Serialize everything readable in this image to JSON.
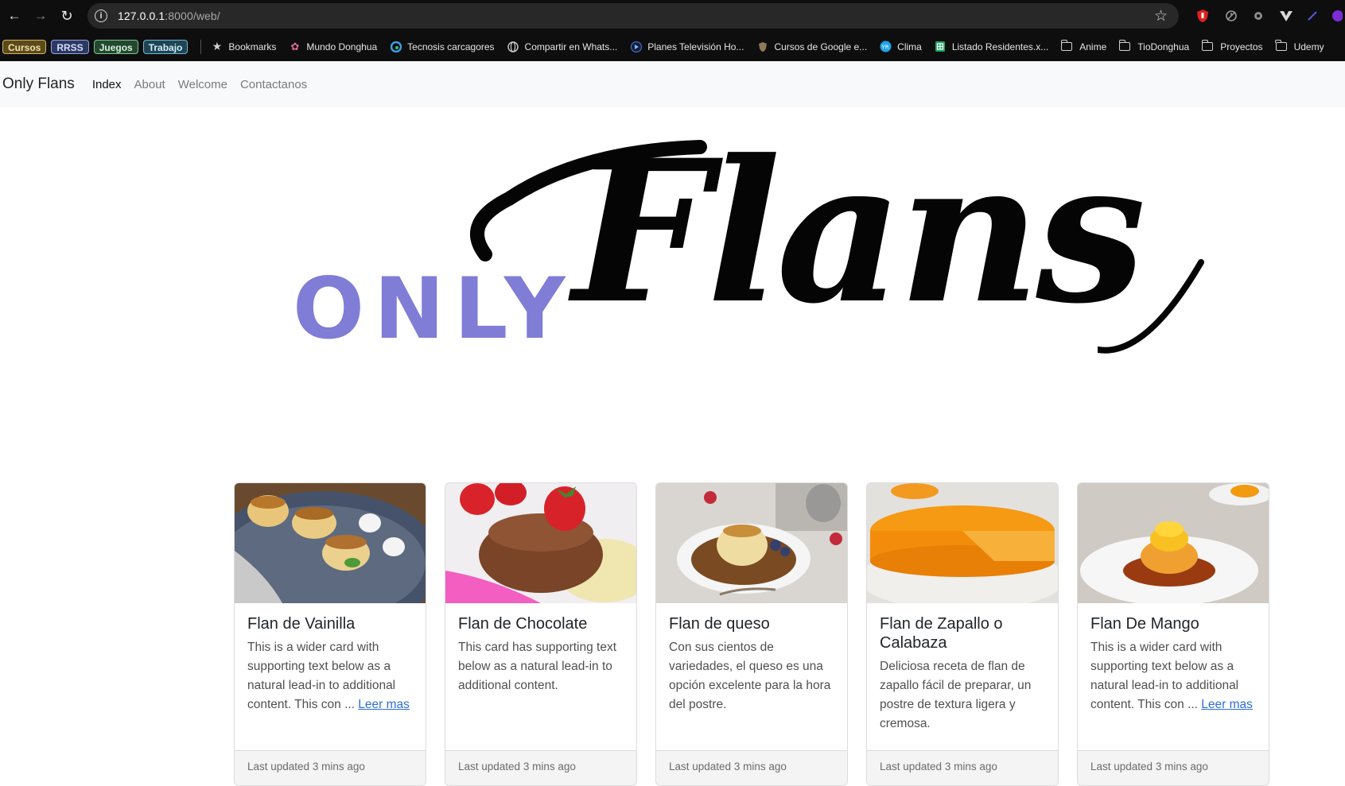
{
  "browser": {
    "url_host": "127.0.0.1",
    "url_rest": ":8000/web/",
    "bookmark_tags": [
      "Cursos",
      "RRSS",
      "Juegos",
      "Trabajo"
    ],
    "bookmarks": [
      {
        "label": "Bookmarks",
        "icon": "star-icon"
      },
      {
        "label": "Mundo Donghua",
        "icon": "flower-icon"
      },
      {
        "label": "Tecnosis carcagores",
        "icon": "edge-icon"
      },
      {
        "label": "Compartir en Whats...",
        "icon": "globe-icon"
      },
      {
        "label": "Planes Televisión Ho...",
        "icon": "play-icon"
      },
      {
        "label": "Cursos de Google e...",
        "icon": "shield-icon"
      },
      {
        "label": "Clima",
        "icon": "weather-icon"
      },
      {
        "label": "Listado Residentes.x...",
        "icon": "sheets-icon"
      }
    ],
    "bookmark_folders": [
      "Anime",
      "TioDonghua",
      "Proyectos",
      "Udemy"
    ]
  },
  "navbar": {
    "brand": "Only Flans",
    "links": [
      "Index",
      "About",
      "Welcome",
      "Contactanos"
    ]
  },
  "hero": {
    "only": "ONLY",
    "flans": "Flans"
  },
  "cards": [
    {
      "title": "Flan de Vainilla",
      "text": "This is a wider card with supporting text below as a natural lead-in to additional content. This con ...",
      "link": "Leer mas",
      "footer": "Last updated 3 mins ago"
    },
    {
      "title": "Flan de Chocolate",
      "text": "This card has supporting text below as a natural lead-in to additional content.",
      "link": "",
      "footer": "Last updated 3 mins ago"
    },
    {
      "title": "Flan de queso",
      "text": "Con sus cientos de variedades, el queso es una opción excelente para la hora del postre.",
      "link": "",
      "footer": "Last updated 3 mins ago"
    },
    {
      "title": "Flan de Zapallo o Calabaza",
      "text": "Deliciosa receta de flan de zapallo fácil de preparar, un postre de textura ligera y cremosa.",
      "link": "",
      "footer": "Last updated 3 mins ago"
    },
    {
      "title": "Flan De Mango",
      "text": "This is a wider card with supporting text below as a natural lead-in to additional content. This con ...",
      "link": "Leer mas",
      "footer": "Last updated 3 mins ago"
    }
  ]
}
